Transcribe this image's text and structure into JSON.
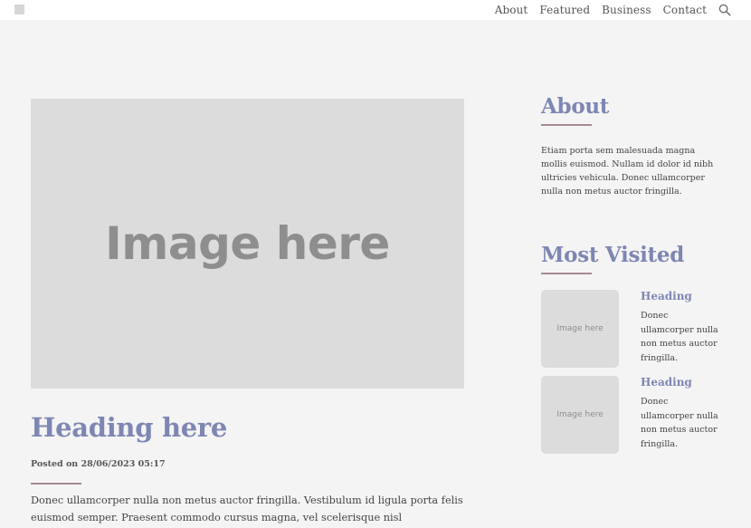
{
  "nav": {
    "items": [
      {
        "label": "About"
      },
      {
        "label": "Featured"
      },
      {
        "label": "Business"
      },
      {
        "label": "Contact"
      }
    ],
    "search_icon": "search-icon"
  },
  "post": {
    "image_placeholder": "Image here",
    "heading": "Heading here",
    "meta": "Posted on 28/06/2023 05:17",
    "excerpt": "Donec ullamcorper nulla non metus auctor fringilla. Vestibulum id ligula porta felis euismod semper. Praesent commodo cursus magna, vel scelerisque nisl consectetur."
  },
  "sidebar": {
    "about": {
      "title": "About",
      "text": "Etiam porta sem malesuada magna mollis euismod. Nullam id dolor id nibh ultricies vehicula. Donec ullamcorper nulla non metus auctor fringilla."
    },
    "most_visited": {
      "title": "Most Visited",
      "items": [
        {
          "thumb": "Image here",
          "heading": "Heading",
          "text": "Donec ullamcorper nulla non metus auctor fringilla."
        },
        {
          "thumb": "Image here",
          "heading": "Heading",
          "text": "Donec ullamcorper nulla non metus auctor fringilla."
        }
      ]
    }
  },
  "colors": {
    "accent": "#7e86b2",
    "rule": "#a88a93",
    "background": "#f4f4f5",
    "placeholder": "#dcdcdc"
  }
}
